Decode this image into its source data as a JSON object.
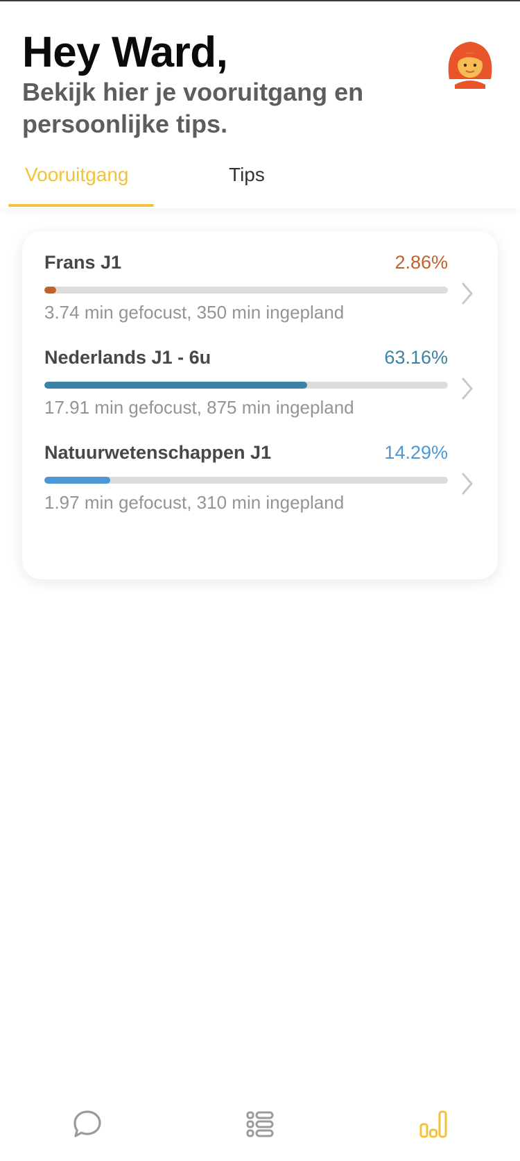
{
  "header": {
    "greeting": "Hey Ward,",
    "subtitle": "Bekijk hier je vooruitgang en persoonlijke tips.",
    "avatar_icon": "user-avatar-red-hair"
  },
  "tabs": [
    {
      "label": "Vooruitgang",
      "active": true
    },
    {
      "label": "Tips",
      "active": false
    }
  ],
  "colors": {
    "accent": "#f2c23a",
    "frans": "#c1612c",
    "nederlands": "#3b82a6",
    "natuur": "#4f97d4",
    "track": "#dcdcdc"
  },
  "courses": [
    {
      "name": "Frans J1",
      "percent_label": "2.86%",
      "progress": 0.0286,
      "meta": "3.74 min gefocust, 350 min ingepland",
      "color": "#c1612c"
    },
    {
      "name": "Nederlands J1 - 6u",
      "percent_label": "63.16%",
      "progress": 0.6516,
      "meta": "17.91 min gefocust, 875 min ingepland",
      "color": "#3b82a6"
    },
    {
      "name": "Natuurwetenschappen J1",
      "percent_label": "14.29%",
      "progress": 0.1629,
      "meta": "1.97 min gefocust, 310 min ingepland",
      "color": "#4f97d4"
    }
  ],
  "bottom_nav": [
    {
      "icon": "chat-bubble-icon",
      "active": false
    },
    {
      "icon": "list-icon",
      "active": false
    },
    {
      "icon": "bar-chart-icon",
      "active": true
    }
  ]
}
